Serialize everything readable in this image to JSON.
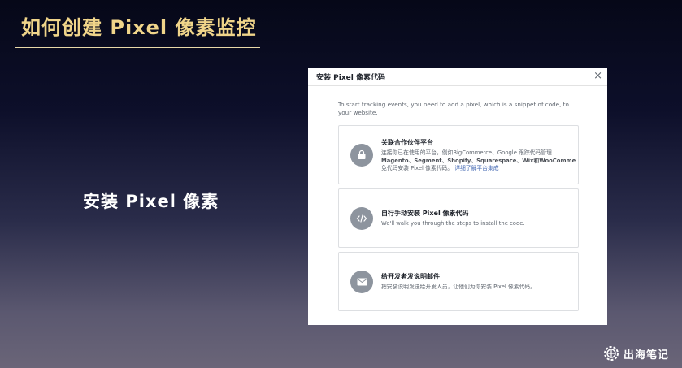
{
  "slide": {
    "title": "如何创建 Pixel 像素监控",
    "subtitle": "安装 Pixel 像素"
  },
  "dialog": {
    "title": "安装 Pixel 像素代码",
    "close_icon": "×",
    "intro": "To start tracking events, you need to add a pixel, which is a snippet of code, to your website.",
    "options": [
      {
        "icon": "shopping-bag-icon",
        "title": "关联合作伙伴平台",
        "desc_line1": "连接你已在使用的平台，例如BigCommerce、Google 跟踪代码管理",
        "desc_line2": "Magento、Segment、Shopify、Squarespace、Wix和WooComme",
        "desc_line3": "免代码安装 Pixel 像素代码。",
        "link": "详细了解平台集成"
      },
      {
        "icon": "code-icon",
        "title": "自行手动安装 Pixel 像素代码",
        "desc_line1": "We'll walk you through the steps to install the code."
      },
      {
        "icon": "envelope-icon",
        "title": "给开发者发说明邮件",
        "desc_line1": "把安装说明发送给开发人员，让他们为你安装 Pixel 像素代码。"
      }
    ]
  },
  "logo": {
    "icon": "gear-badge-icon",
    "text": "出海笔记"
  }
}
